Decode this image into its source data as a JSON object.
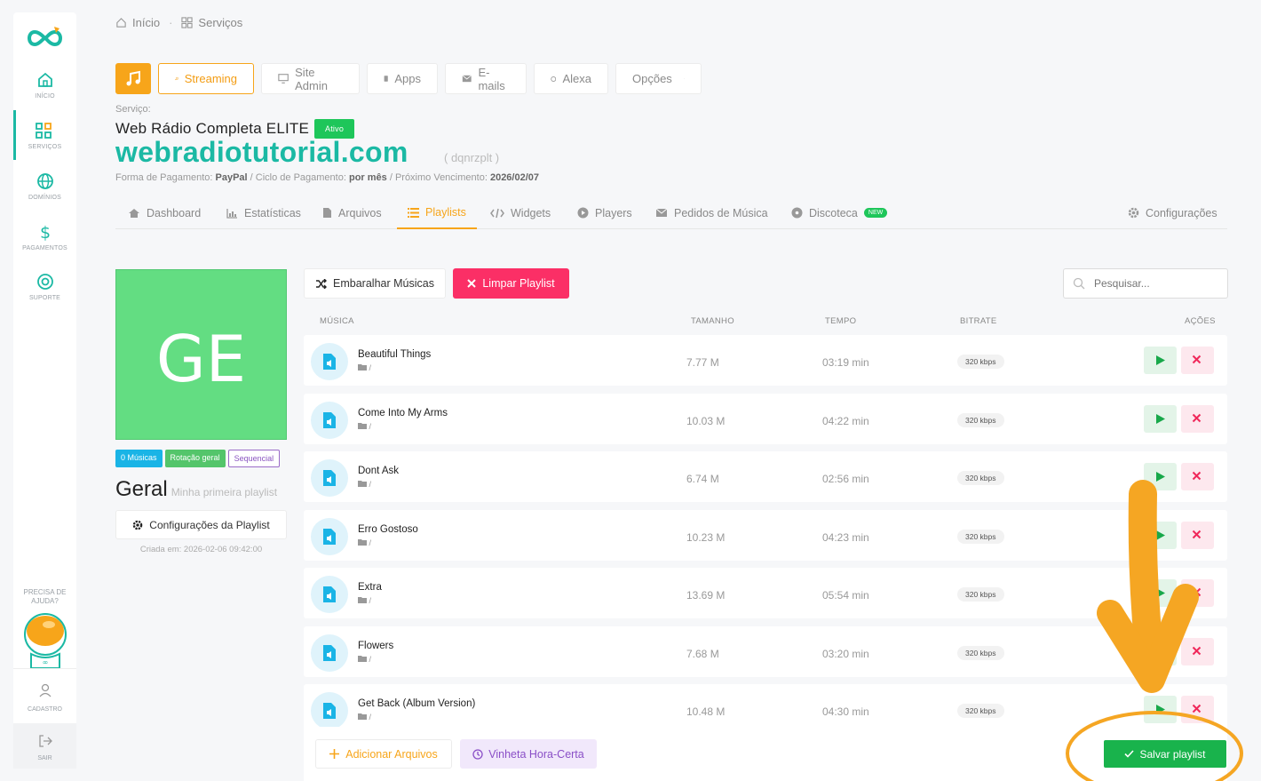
{
  "sidebar": {
    "items": [
      {
        "label": "INÍCIO",
        "icon": "home-icon"
      },
      {
        "label": "SERVIÇOS",
        "icon": "grid-icon"
      },
      {
        "label": "DOMÍNIOS",
        "icon": "globe-icon"
      },
      {
        "label": "PAGAMENTOS",
        "icon": "dollar-icon"
      },
      {
        "label": "SUPORTE",
        "icon": "lifebuoy-icon"
      }
    ],
    "help_label": "PRECISA DE AJUDA?",
    "cadastro_label": "CADASTRO",
    "sair_label": "SAIR"
  },
  "breadcrumb": {
    "home": "Início",
    "current": "Serviços",
    "separator": "·"
  },
  "top_tabs": [
    "Streaming",
    "Site Admin",
    "Apps",
    "E-mails",
    "Alexa",
    "Opções"
  ],
  "service": {
    "label": "Serviço:",
    "name": "Web Rádio Completa ELITE",
    "status": "Ativo",
    "domain": "webradiotutorial.com",
    "id": "( dqnrzplt )",
    "pay_label": "Forma de Pagamento:",
    "pay_value": "PayPal",
    "cycle_label": "/ Ciclo de Pagamento:",
    "cycle_value": "por mês",
    "due_label": "/ Próximo Vencimento:",
    "due_value": "2026/02/07"
  },
  "sub_tabs": [
    {
      "label": "Dashboard"
    },
    {
      "label": "Estatísticas"
    },
    {
      "label": "Arquivos"
    },
    {
      "label": "Playlists"
    },
    {
      "label": "Widgets"
    },
    {
      "label": "Players"
    },
    {
      "label": "Pedidos de Música"
    },
    {
      "label": "Discoteca",
      "badge": "NEW"
    },
    {
      "label": "Configurações"
    }
  ],
  "playlist": {
    "cover_initials": "GE",
    "pills": [
      "0 Músicas",
      "Rotação geral",
      "Sequencial"
    ],
    "title": "Geral",
    "subtitle": "Minha primeira playlist",
    "config_label": "Configurações da Playlist",
    "created": "Criada em: 2026-02-06 09:42:00"
  },
  "actions": {
    "shuffle": "Embaralhar Músicas",
    "clear": "Limpar Playlist",
    "search_placeholder": "Pesquisar..."
  },
  "table": {
    "headers": [
      "MÚSICA",
      "TAMANHO",
      "TEMPO",
      "BITRATE",
      "AÇÕES"
    ],
    "rows": [
      {
        "name": "Beautiful Things",
        "path": "/",
        "size": "7.77 M",
        "time": "03:19 min",
        "bitrate": "320 kbps"
      },
      {
        "name": "Come Into My Arms",
        "path": "/",
        "size": "10.03 M",
        "time": "04:22 min",
        "bitrate": "320 kbps"
      },
      {
        "name": "Dont Ask",
        "path": "/",
        "size": "6.74 M",
        "time": "02:56 min",
        "bitrate": "320 kbps"
      },
      {
        "name": "Erro Gostoso",
        "path": "/",
        "size": "10.23 M",
        "time": "04:23 min",
        "bitrate": "320 kbps"
      },
      {
        "name": "Extra",
        "path": "/",
        "size": "13.69 M",
        "time": "05:54 min",
        "bitrate": "320 kbps"
      },
      {
        "name": "Flowers",
        "path": "/",
        "size": "7.68 M",
        "time": "03:20 min",
        "bitrate": "320 kbps"
      },
      {
        "name": "Get Back (Album Version)",
        "path": "/",
        "size": "10.48 M",
        "time": "04:30 min",
        "bitrate": "320 kbps"
      }
    ]
  },
  "footer": {
    "add": "Adicionar Arquivos",
    "vinheta": "Vinheta Hora-Certa",
    "save": "Salvar playlist"
  },
  "colors": {
    "brand": "#1bb9a4",
    "accent": "#f7a51a",
    "danger": "#fb2f66",
    "success": "#19b34c",
    "annotation": "#f5a623"
  }
}
